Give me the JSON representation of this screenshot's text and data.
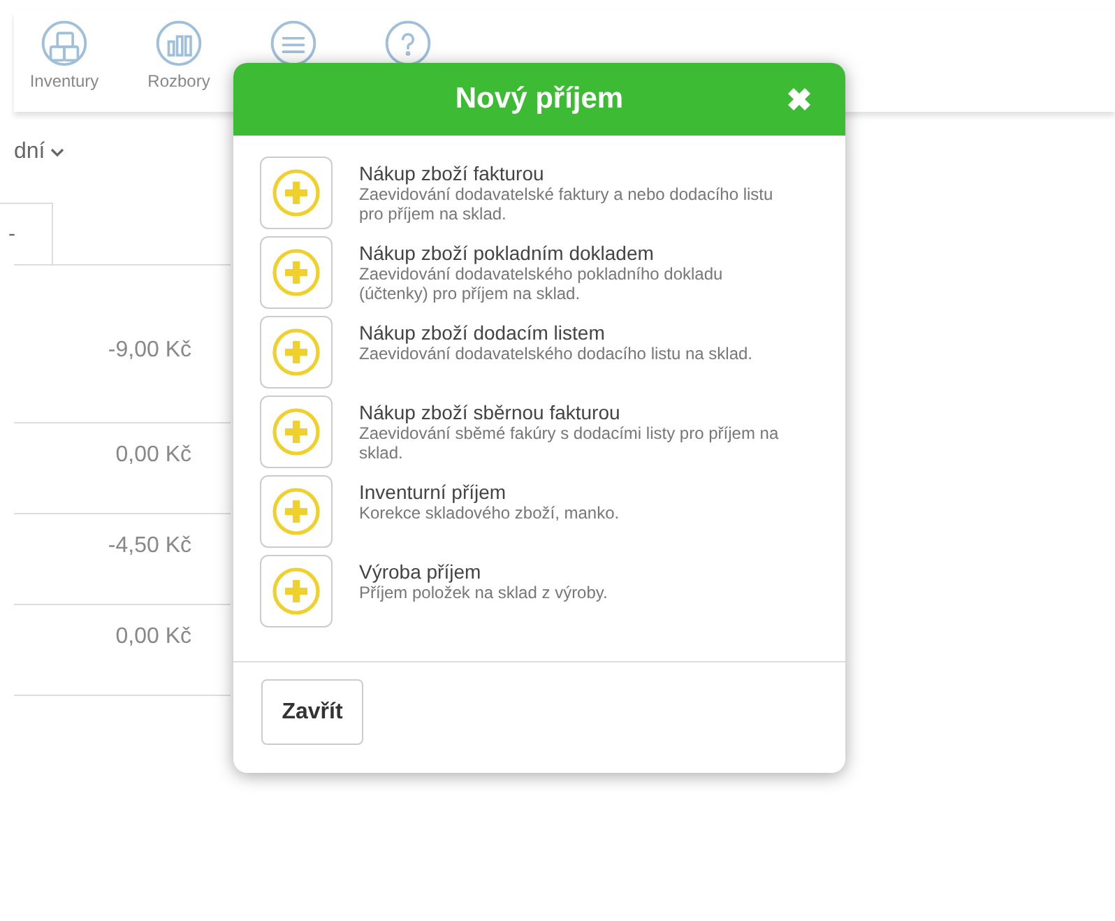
{
  "nav": [
    {
      "label": "Inventury"
    },
    {
      "label": "Rozbory"
    }
  ],
  "filter": {
    "label": "dní"
  },
  "tab": {
    "label": "-"
  },
  "amounts": [
    "-9,00 Kč",
    "0,00 Kč",
    "-4,50 Kč",
    "0,00 Kč"
  ],
  "dialog": {
    "title": "Nový příjem",
    "items": [
      {
        "title": "Nákup zboží fakturou",
        "description": "Zaevidování dodavatelské faktury a nebo dodacího listu pro příjem na sklad."
      },
      {
        "title": "Nákup zboží pokladním dokladem",
        "description": "Zaevidování dodavatelského pokladního dokladu (účtenky) pro příjem na sklad."
      },
      {
        "title": "Nákup zboží dodacím listem",
        "description": "Zaevidování dodavatelského dodacího listu na sklad."
      },
      {
        "title": "Nákup zboží sběrnou fakturou",
        "description": "Zaevidování sběmé fakúry s dodacími listy pro příjem na sklad."
      },
      {
        "title": "Inventurní příjem",
        "description": "Korekce skladového zboží, manko."
      },
      {
        "title": "Výroba příjem",
        "description": "Příjem položek na sklad z výroby."
      }
    ],
    "buttons": [
      "Zavřít"
    ]
  }
}
